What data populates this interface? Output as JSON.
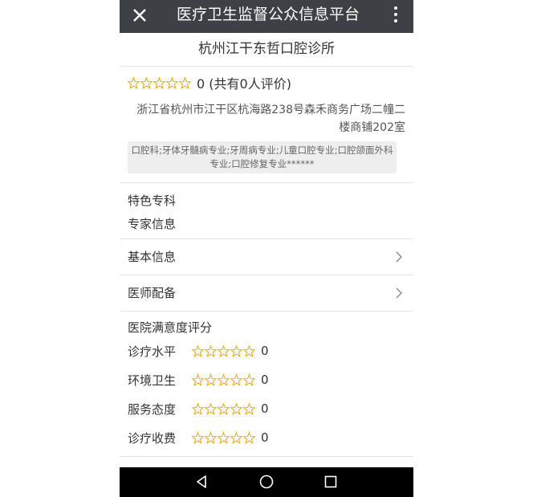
{
  "header": {
    "title": "医疗卫生监督公众信息平台",
    "close_icon": "close-icon",
    "more_icon": "more-vertical-icon"
  },
  "clinic": {
    "name": "杭州江干东哲口腔诊所",
    "rating": 0,
    "rating_text": "0 (共有0人评价)",
    "address": "浙江省杭州市江干区杭海路238号森禾商务广场二幢二楼商铺202室",
    "specialties": "口腔科;牙体牙髓病专业;牙周病专业;儿童口腔专业;口腔颌面外科专业;口腔修复专业******"
  },
  "sections": {
    "featured": "特色专科",
    "experts": "专家信息",
    "basic_info": "基本信息",
    "staffing": "医师配备"
  },
  "satisfaction": {
    "title": "医院满意度评分",
    "items": [
      {
        "label": "诊疗水平",
        "value": "0"
      },
      {
        "label": "环境卫生",
        "value": "0"
      },
      {
        "label": "服务态度",
        "value": "0"
      },
      {
        "label": "诊疗收费",
        "value": "0"
      }
    ]
  },
  "colors": {
    "titlebar": "#3d4145",
    "star": "#f0a500",
    "navbar": "#000000"
  },
  "system_nav": {
    "back_icon": "back-triangle-icon",
    "home_icon": "home-circle-icon",
    "recents_icon": "recents-square-icon"
  }
}
